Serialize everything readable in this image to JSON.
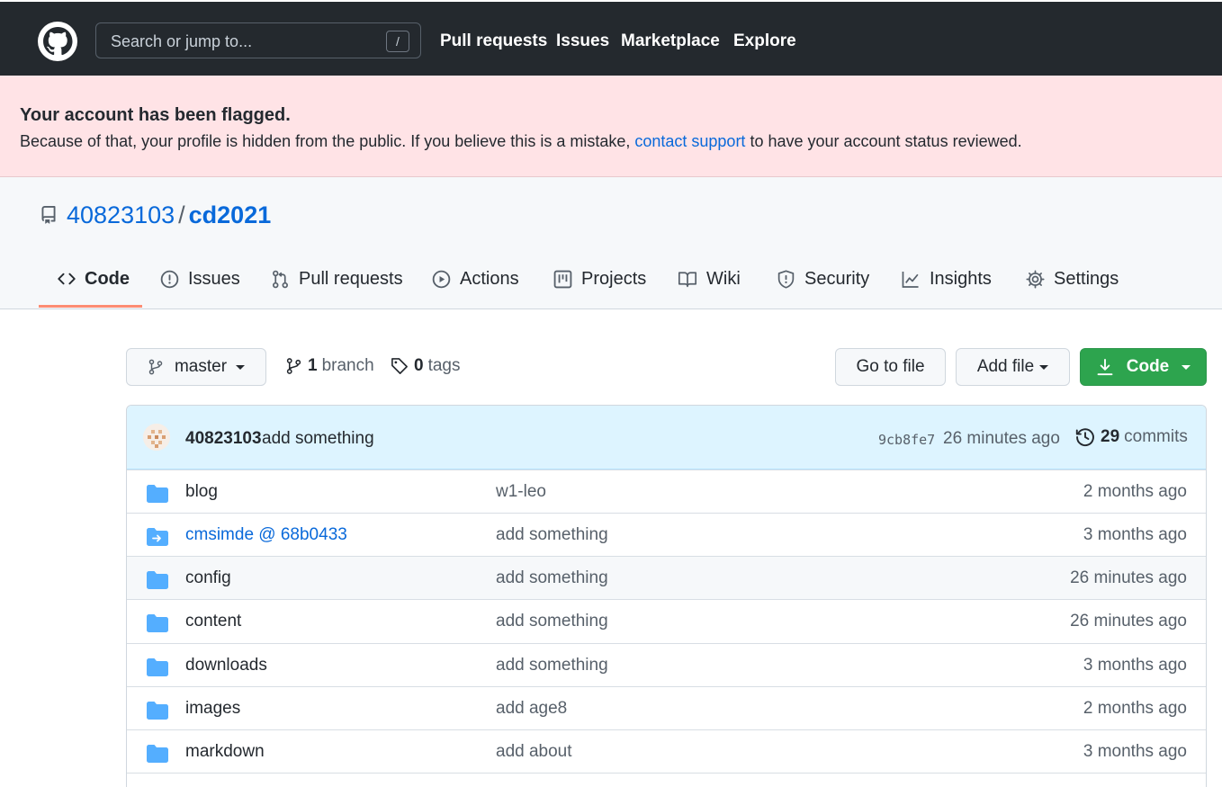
{
  "header": {
    "search_placeholder": "Search or jump to...",
    "search_shortcut": "/",
    "nav": [
      "Pull requests",
      "Issues",
      "Marketplace",
      "Explore"
    ]
  },
  "flash": {
    "title": "Your account has been flagged.",
    "body_before": "Because of that, your profile is hidden from the public. If you believe this is a mistake, ",
    "link": "contact support",
    "body_after": " to have your account status reviewed."
  },
  "repo": {
    "owner": "40823103",
    "separator": "/",
    "name": "cd2021"
  },
  "tabs": [
    {
      "label": "Code",
      "icon": "code-icon",
      "selected": true
    },
    {
      "label": "Issues",
      "icon": "issue-icon"
    },
    {
      "label": "Pull requests",
      "icon": "pull-request-icon"
    },
    {
      "label": "Actions",
      "icon": "play-icon"
    },
    {
      "label": "Projects",
      "icon": "project-icon"
    },
    {
      "label": "Wiki",
      "icon": "book-icon"
    },
    {
      "label": "Security",
      "icon": "shield-icon"
    },
    {
      "label": "Insights",
      "icon": "graph-icon"
    },
    {
      "label": "Settings",
      "icon": "gear-icon"
    }
  ],
  "toolbar": {
    "branch": "master",
    "branch_count": "1",
    "branch_label": "branch",
    "tag_count": "0",
    "tag_label": "tags",
    "go_to_file": "Go to file",
    "add_file": "Add file",
    "code": "Code"
  },
  "latest_commit": {
    "author": "40823103",
    "message": "add something",
    "sha": "9cb8fe7",
    "time": "26 minutes ago",
    "commit_count": "29",
    "commit_label": "commits"
  },
  "files": [
    {
      "name": "blog",
      "type": "folder",
      "message": "w1-leo",
      "time": "2 months ago"
    },
    {
      "name": "cmsimde @ 68b0433",
      "type": "submodule",
      "message": "add something",
      "time": "3 months ago"
    },
    {
      "name": "config",
      "type": "folder",
      "message": "add something",
      "time": "26 minutes ago"
    },
    {
      "name": "content",
      "type": "folder",
      "message": "add something",
      "time": "26 minutes ago"
    },
    {
      "name": "downloads",
      "type": "folder",
      "message": "add something",
      "time": "3 months ago"
    },
    {
      "name": "images",
      "type": "folder",
      "message": "add age8",
      "time": "2 months ago"
    },
    {
      "name": "markdown",
      "type": "folder",
      "message": "add about",
      "time": "3 months ago"
    }
  ],
  "colors": {
    "header_bg": "#24292e",
    "flash_bg": "#ffe3e6",
    "link": "#0969da",
    "green": "#2da44e",
    "tab_underline": "#fd8c73",
    "folder": "#54aeff"
  }
}
